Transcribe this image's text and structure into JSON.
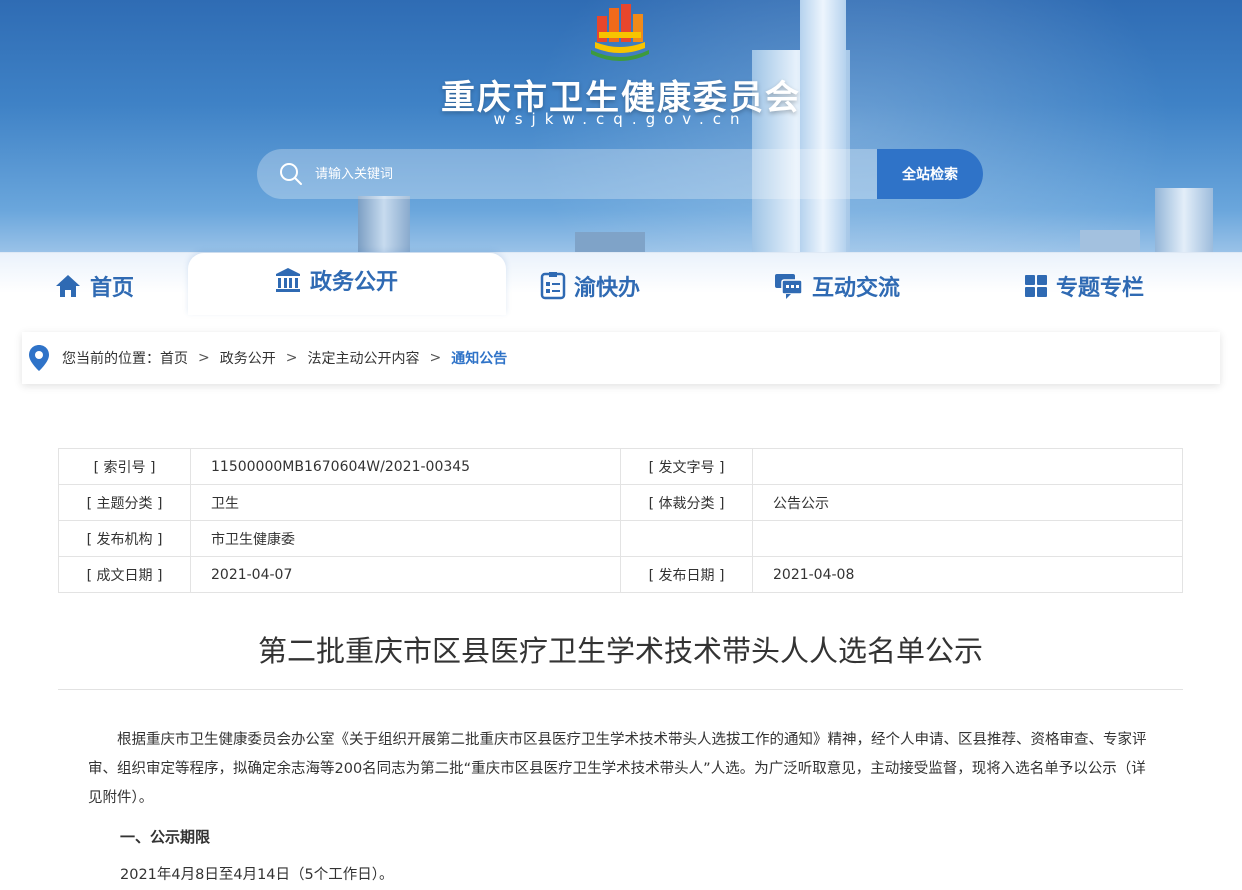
{
  "header": {
    "site_title": "重庆市卫生健康委员会",
    "site_domain": "wsjkw.cq.gov.cn",
    "search": {
      "placeholder": "请输入关键词",
      "button_label": "全站检索"
    }
  },
  "nav": {
    "items": [
      {
        "label": "首页",
        "icon": "home-icon"
      },
      {
        "label": "政务公开",
        "icon": "government-building-icon",
        "active": true
      },
      {
        "label": "渝快办",
        "icon": "form-list-icon"
      },
      {
        "label": "互动交流",
        "icon": "chat-bubbles-icon"
      },
      {
        "label": "专题专栏",
        "icon": "grid-squares-icon"
      }
    ]
  },
  "breadcrumb": {
    "prefix": "您当前的位置：",
    "items": [
      "首页",
      "政务公开",
      "法定主动公开内容",
      "通知公告"
    ],
    "separator": ">"
  },
  "meta": {
    "rows": [
      {
        "k1": "[ 索引号 ]",
        "v1": "11500000MB1670604W/2021-00345",
        "k2": "[ 发文字号 ]",
        "v2": ""
      },
      {
        "k1": "[ 主题分类 ]",
        "v1": "卫生",
        "k2": "[ 体裁分类 ]",
        "v2": "公告公示"
      },
      {
        "k1": "[ 发布机构 ]",
        "v1": "市卫生健康委",
        "k2": "",
        "v2": ""
      },
      {
        "k1": "[ 成文日期 ]",
        "v1": "2021-04-07",
        "k2": "[ 发布日期 ]",
        "v2": "2021-04-08"
      }
    ]
  },
  "article": {
    "title": "第二批重庆市区县医疗卫生学术技术带头人人选名单公示",
    "intro": "根据重庆市卫生健康委员会办公室《关于组织开展第二批重庆市区县医疗卫生学术技术带头人选拔工作的通知》精神，经个人申请、区县推荐、资格审查、专家评审、组织审定等程序，拟确定余志海等200名同志为第二批“重庆市区县医疗卫生学术技术带头人”人选。为广泛听取意见，主动接受监督，现将入选名单予以公示（详见附件）。",
    "section1_heading": "一、公示期限",
    "section1_text": "2021年4月8日至4月14日（5个工作日）。"
  },
  "colors": {
    "brand_blue": "#2f73c8",
    "nav_text": "#2f6ab3"
  }
}
